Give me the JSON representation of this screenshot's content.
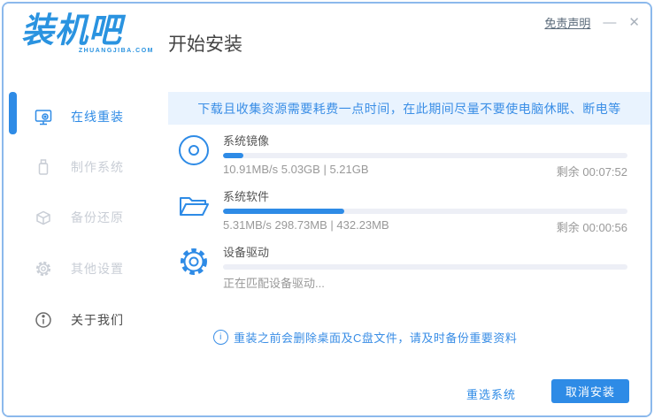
{
  "window": {
    "disclaimer": "免责声明",
    "minimize": "—",
    "close": "✕"
  },
  "logo": {
    "text": "装机吧",
    "subtext": "ZHUANGJIBA.COM"
  },
  "header": {
    "title": "开始安装"
  },
  "sidebar": {
    "items": [
      {
        "label": "在线重装",
        "state": "active"
      },
      {
        "label": "制作系统",
        "state": "disabled"
      },
      {
        "label": "备份还原",
        "state": "disabled"
      },
      {
        "label": "其他设置",
        "state": "disabled"
      },
      {
        "label": "关于我们",
        "state": "normal"
      }
    ]
  },
  "main": {
    "notice": "下载且收集资源需要耗费一点时间，在此期间尽量不要使电脑休眠、断电等",
    "tasks": [
      {
        "icon": "disc-icon",
        "label": "系统镜像",
        "progress": 5,
        "stats": "10.91MB/s 5.03GB | 5.21GB",
        "remaining": "剩余 00:07:52"
      },
      {
        "icon": "folder-icon",
        "label": "系统软件",
        "progress": 30,
        "stats": "5.31MB/s 298.73MB | 432.23MB",
        "remaining": "剩余 00:00:56"
      },
      {
        "icon": "gear-icon",
        "label": "设备驱动",
        "progress": 0,
        "stats": "正在匹配设备驱动...",
        "remaining": ""
      }
    ],
    "warning": "重装之前会删除桌面及C盘文件，请及时备份重要资料",
    "warning_icon_glyph": "i"
  },
  "footer": {
    "reselect": "重选系统",
    "cancel": "取消安装"
  },
  "colors": {
    "accent": "#2e8be6",
    "logo_blue": "#2a93e0",
    "notice_bg": "#e9f3fe",
    "notice_text": "#3a8ee6",
    "disabled_gray": "#c9ced6",
    "bar_track": "#edeff6",
    "window_border": "#8cb9ec"
  }
}
